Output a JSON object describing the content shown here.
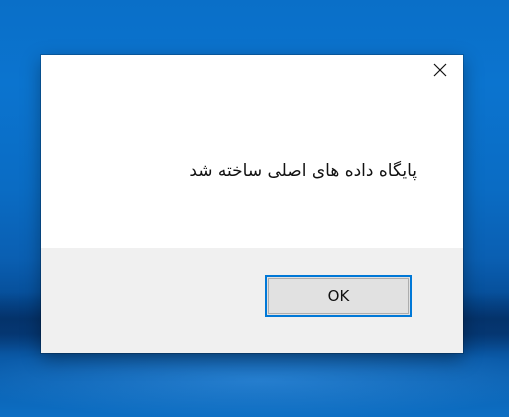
{
  "dialog": {
    "message": "پایگاه داده های اصلی ساخته شد",
    "ok_label": "OK",
    "close_icon": "close-icon"
  },
  "colors": {
    "desktop_blue": "#0a6cc4",
    "dialog_bg": "#ffffff",
    "footer_bg": "#f0f0f0",
    "button_focus_border": "#0078d7",
    "button_bg": "#e1e1e1"
  }
}
